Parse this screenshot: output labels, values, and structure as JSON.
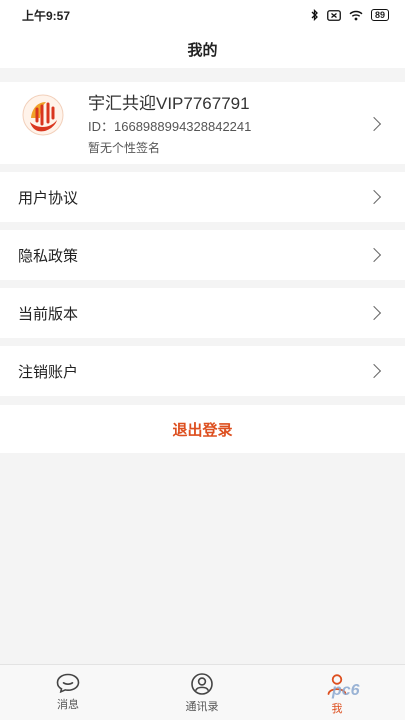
{
  "status_bar": {
    "time": "上午9:57",
    "battery": "89",
    "icons": [
      "bluetooth-icon",
      "mute-icon",
      "wifi-icon",
      "battery-icon"
    ]
  },
  "header": {
    "title": "我的"
  },
  "profile": {
    "name": "宇汇共迎VIP7767791",
    "id_text": "ID：1668988994328842241",
    "signature": "暂无个性签名"
  },
  "menu": {
    "items": [
      {
        "label": "用户协议"
      },
      {
        "label": "隐私政策"
      },
      {
        "label": "当前版本"
      },
      {
        "label": "注销账户"
      }
    ]
  },
  "logout": {
    "label": "退出登录"
  },
  "bottom_nav": {
    "items": [
      {
        "label": "消息",
        "icon": "message-icon"
      },
      {
        "label": "通讯录",
        "icon": "contacts-icon"
      },
      {
        "label": "我",
        "icon": "user-icon"
      }
    ]
  },
  "watermark": {
    "text": "pc6"
  },
  "colors": {
    "accent": "#dd4f1f",
    "background": "#f4f4f4"
  }
}
